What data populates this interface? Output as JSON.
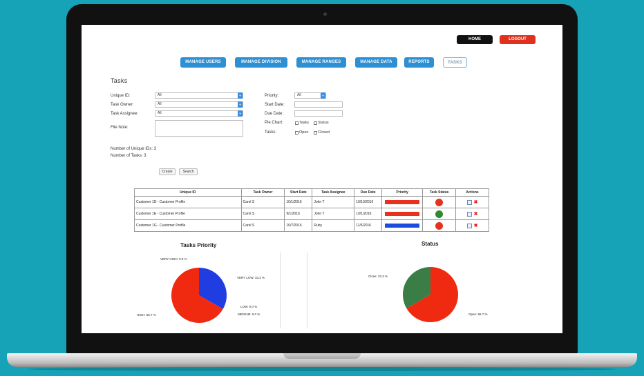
{
  "header": {
    "home_label": "HOME",
    "logout_label": "LOGOUT"
  },
  "nav": [
    {
      "label": "MANAGE USERS",
      "active": false
    },
    {
      "label": "MANAGE DIVISION",
      "active": false
    },
    {
      "label": "MANAGE RANGES",
      "active": false
    },
    {
      "label": "MANAGE DATA",
      "active": false
    },
    {
      "label": "REPORTS",
      "active": false
    },
    {
      "label": "TASKS",
      "active": true
    }
  ],
  "page_title": "Tasks",
  "filters": {
    "unique_id": {
      "label": "Unique ID:",
      "value": "All"
    },
    "task_owner": {
      "label": "Task Owner:",
      "value": "All"
    },
    "task_assignee": {
      "label": "Task Assignee:",
      "value": "All"
    },
    "file_note": {
      "label": "File Note:"
    },
    "priority": {
      "label": "Priority:",
      "value": "All"
    },
    "start_date": {
      "label": "Start Date:"
    },
    "due_date": {
      "label": "Due Date:"
    },
    "pie_chart": {
      "label": "Pie Chart:",
      "opt1": "Tasks",
      "opt2": "Status"
    },
    "tasks": {
      "label": "Tasks:",
      "opt1": "Open",
      "opt2": "Closed"
    }
  },
  "summary": {
    "unique_ids": "Number of Unique IDs: 3",
    "tasks": "Number of Tasks: 3"
  },
  "buttons": {
    "create": "Create",
    "search": "Search"
  },
  "table": {
    "headers": [
      "Unique ID",
      "Task Owner",
      "Start Date",
      "Task Assignee",
      "Due Date",
      "Priority",
      "Task Status",
      "Actions"
    ],
    "rows": [
      {
        "unique_id": "Customer 1D - Customer Profile",
        "owner": "Carol S",
        "start": "10/1/2016",
        "assignee": "John T",
        "due": "10/10/2016",
        "priority_color": "#e8311d",
        "status_color": "#e8311d"
      },
      {
        "unique_id": "Customer 1E - Customer Profile",
        "owner": "Carol S",
        "start": "9/1/2016",
        "assignee": "John T",
        "due": "10/1/2016",
        "priority_color": "#e8311d",
        "status_color": "#2e8b2e"
      },
      {
        "unique_id": "Customer 1G - Customer Profile",
        "owner": "Carol S",
        "start": "10/7/2016",
        "assignee": "Ruby",
        "due": "11/6/2016",
        "priority_color": "#1d4de0",
        "status_color": "#e8311d"
      }
    ]
  },
  "charts": {
    "priority": {
      "title": "Tasks Priority",
      "labels": {
        "very_high": "VERY HIGH: 0.0 %",
        "very_low": "VERY LOW: 33.3 %",
        "low": "LOW: 0.0 %",
        "medium": "MEDIUM: 0.0 %",
        "high": "HIGH: 66.7 %"
      },
      "slices": [
        {
          "name": "VERY LOW",
          "percent": 33.3,
          "color": "#1f3de0"
        },
        {
          "name": "HIGH",
          "percent": 66.7,
          "color": "#f02a10"
        }
      ]
    },
    "status": {
      "title": "Status",
      "labels": {
        "close": "Close: 33.3 %",
        "open": "Open: 66.7 %"
      },
      "slices": [
        {
          "name": "Open",
          "percent": 66.7,
          "color": "#f02a10"
        },
        {
          "name": "Close",
          "percent": 33.3,
          "color": "#3a7d46"
        }
      ]
    }
  }
}
